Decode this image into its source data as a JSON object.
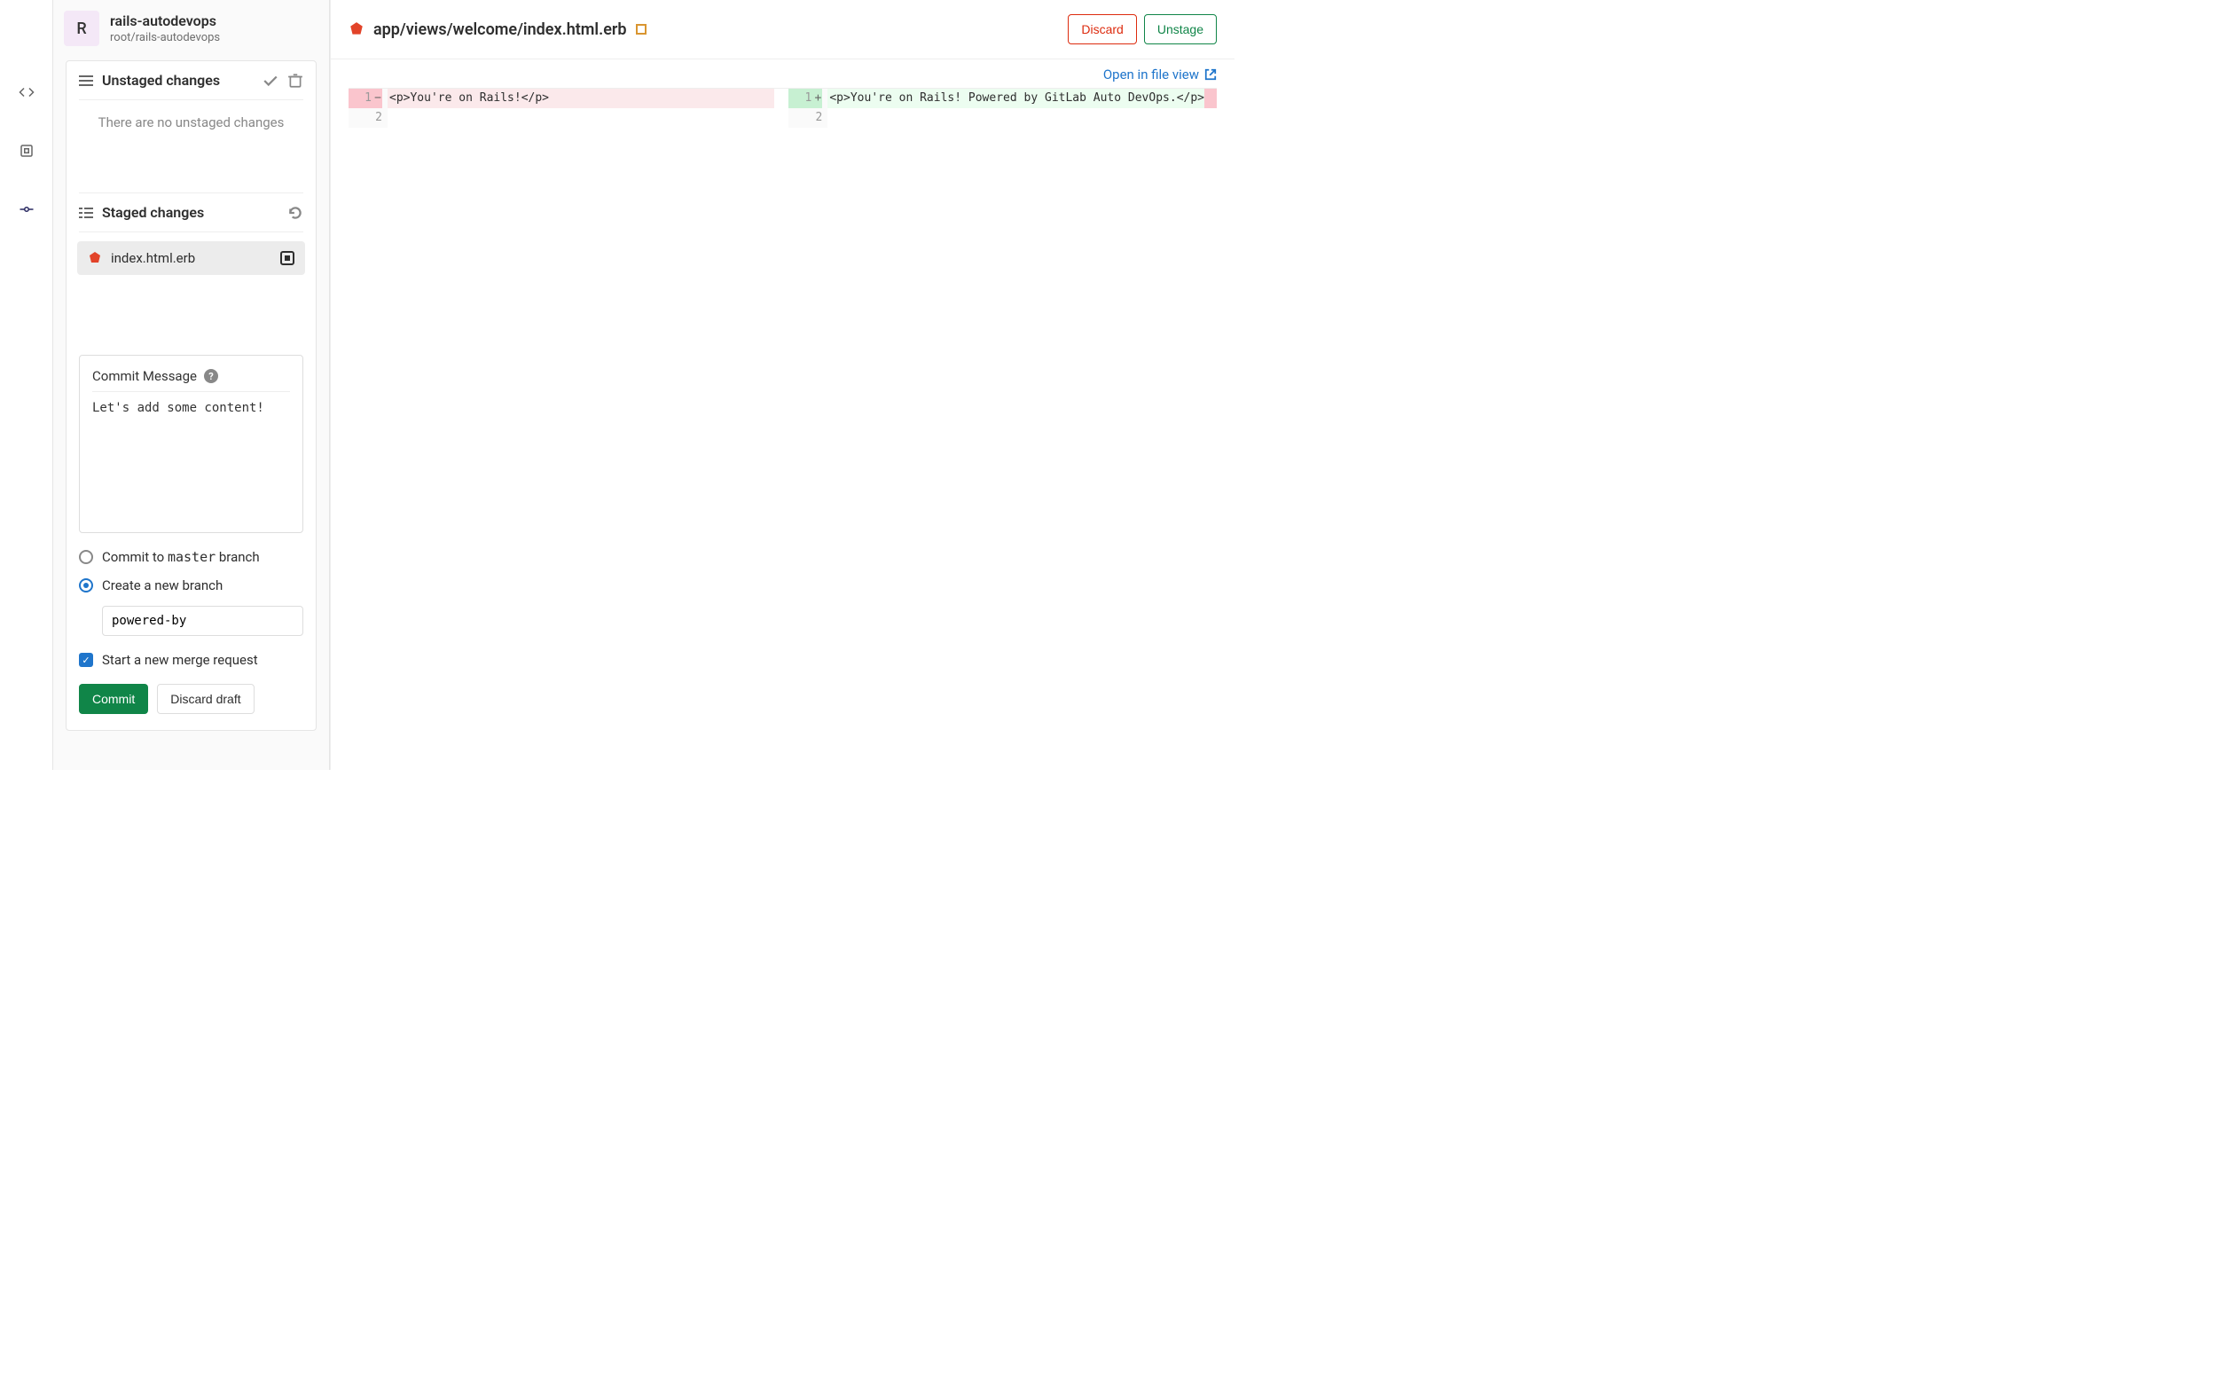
{
  "project": {
    "avatar_letter": "R",
    "name": "rails-autodevops",
    "path": "root/rails-autodevops"
  },
  "unstaged": {
    "title": "Unstaged changes",
    "empty": "There are no unstaged changes"
  },
  "staged": {
    "title": "Staged changes",
    "file": "index.html.erb"
  },
  "commit": {
    "label": "Commit Message",
    "message": "Let's add some content!",
    "radio_master_pre": "Commit to ",
    "radio_master_branch": "master",
    "radio_master_post": " branch",
    "radio_newbranch": "Create a new branch",
    "branch_name": "powered-by",
    "start_mr": "Start a new merge request",
    "commit_btn": "Commit",
    "discard_draft_btn": "Discard draft"
  },
  "editor": {
    "file_path": "app/views/welcome/index.html.erb",
    "discard_btn": "Discard",
    "unstage_btn": "Unstage",
    "open_link": "Open in file view",
    "diff": {
      "left_lines": [
        "1",
        "2"
      ],
      "right_lines": [
        "1",
        "2"
      ],
      "left_code": "<p>You're on Rails!</p>",
      "right_code": "<p>You're on Rails! Powered by GitLab Auto DevOps.</p>"
    }
  }
}
